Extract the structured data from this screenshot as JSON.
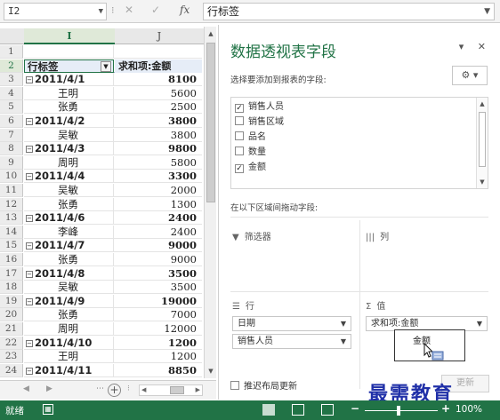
{
  "formula_bar": {
    "name_box": "I2",
    "cancel_glyph": "✕",
    "enter_glyph": "✓",
    "fx_label": "fx",
    "content": "行标签"
  },
  "grid": {
    "col_headers": [
      "I",
      "J"
    ],
    "row_numbers": [
      "1",
      "2",
      "3",
      "4",
      "5",
      "6",
      "7",
      "8",
      "9",
      "10",
      "11",
      "12",
      "13",
      "14",
      "15",
      "16",
      "17",
      "18",
      "19",
      "20",
      "21",
      "22",
      "23",
      "24"
    ],
    "header_row": {
      "label": "行标签",
      "value_label": "求和项:金额"
    },
    "rows": [
      {
        "type": "date",
        "label": "2011/4/1",
        "value": "8100"
      },
      {
        "type": "person",
        "label": "王明",
        "value": "5600"
      },
      {
        "type": "person",
        "label": "张勇",
        "value": "2500"
      },
      {
        "type": "date",
        "label": "2011/4/2",
        "value": "3800"
      },
      {
        "type": "person",
        "label": "吴敏",
        "value": "3800"
      },
      {
        "type": "date",
        "label": "2011/4/3",
        "value": "9800"
      },
      {
        "type": "person",
        "label": "周明",
        "value": "5800"
      },
      {
        "type": "date",
        "label": "2011/4/4",
        "value": "3300"
      },
      {
        "type": "person",
        "label": "吴敏",
        "value": "2000"
      },
      {
        "type": "person",
        "label": "张勇",
        "value": "1300"
      },
      {
        "type": "date",
        "label": "2011/4/6",
        "value": "2400"
      },
      {
        "type": "person",
        "label": "李峰",
        "value": "2400"
      },
      {
        "type": "date",
        "label": "2011/4/7",
        "value": "9000"
      },
      {
        "type": "person",
        "label": "张勇",
        "value": "9000"
      },
      {
        "type": "date",
        "label": "2011/4/8",
        "value": "3500"
      },
      {
        "type": "person",
        "label": "吴敏",
        "value": "3500"
      },
      {
        "type": "date",
        "label": "2011/4/9",
        "value": "19000"
      },
      {
        "type": "person",
        "label": "张勇",
        "value": "7000"
      },
      {
        "type": "person",
        "label": "周明",
        "value": "12000"
      },
      {
        "type": "date",
        "label": "2011/4/10",
        "value": "1200"
      },
      {
        "type": "person",
        "label": "王明",
        "value": "1200"
      },
      {
        "type": "date",
        "label": "2011/4/11",
        "value": "8850"
      }
    ]
  },
  "sheet_tabs": {
    "add_sheet": "+"
  },
  "pivot_pane": {
    "title": "数据透视表字段",
    "controls": "▾ ✕",
    "subtitle": "选择要添加到报表的字段:",
    "gear_button": "⚙ ▾",
    "fields": [
      {
        "label": "销售人员",
        "checked": true
      },
      {
        "label": "销售区域",
        "checked": false
      },
      {
        "label": "品名",
        "checked": false
      },
      {
        "label": "数量",
        "checked": false
      },
      {
        "label": "金额",
        "checked": true
      }
    ],
    "drag_label": "在以下区域间拖动字段:",
    "zones": {
      "filters": {
        "icon": "▼",
        "label": "筛选器"
      },
      "columns": {
        "icon": "|||",
        "label": "列"
      },
      "rows": {
        "icon": "☰",
        "label": "行",
        "items": [
          "日期",
          "销售人员"
        ]
      },
      "values": {
        "icon": "Σ",
        "label": "值",
        "items": [
          "求和项:金额"
        ]
      }
    },
    "drag_tooltip": "金额",
    "defer_label": "推迟布局更新",
    "update_button": "更新"
  },
  "watermark": "最需教育",
  "status_bar": {
    "ready": "就绪",
    "zoom": "100%",
    "zoom_minus": "−",
    "zoom_plus": "+"
  },
  "colors": {
    "accent": "#217346",
    "watermark": "#2030a8"
  }
}
